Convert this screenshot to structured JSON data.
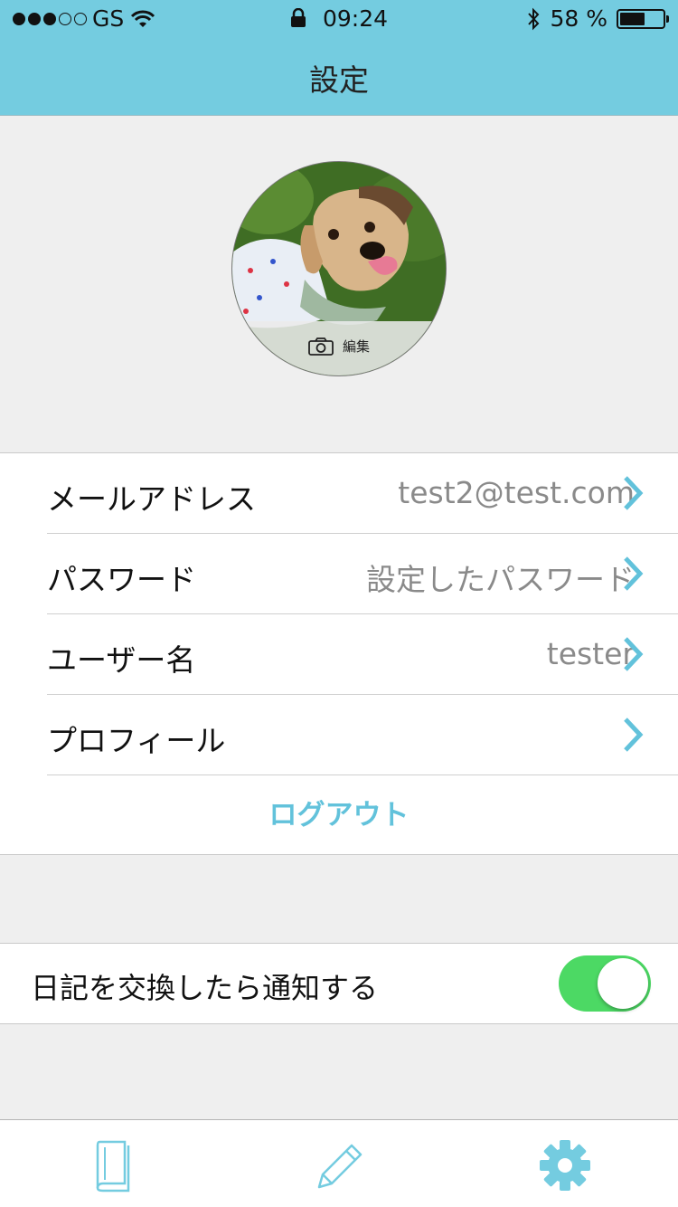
{
  "status_bar": {
    "carrier": "GS",
    "time": "09:24",
    "battery_text": "58 %",
    "battery_level": 0.58
  },
  "nav": {
    "title": "設定"
  },
  "avatar": {
    "edit_label": "編集",
    "icon": "camera-icon"
  },
  "settings": {
    "rows": [
      {
        "label": "メールアドレス",
        "value": "test2@test.com"
      },
      {
        "label": "パスワード",
        "value": "設定したパスワード"
      },
      {
        "label": "ユーザー名",
        "value": "tester"
      },
      {
        "label": "プロフィール",
        "value": ""
      }
    ],
    "logout_label": "ログアウト"
  },
  "notification": {
    "label": "日記を交換したら通知する",
    "enabled": true
  },
  "tabs": [
    {
      "icon": "book-icon"
    },
    {
      "icon": "pencil-icon"
    },
    {
      "icon": "gear-icon"
    }
  ],
  "colors": {
    "header_bg": "#74cce0",
    "accent": "#62c2db",
    "toggle_on": "#4cd964"
  }
}
